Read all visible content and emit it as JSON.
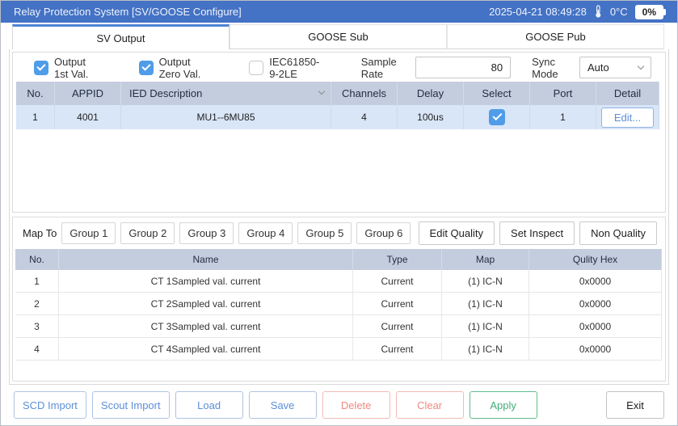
{
  "titlebar": {
    "title": "Relay Protection System [SV/GOOSE Configure]",
    "datetime": "2025-04-21 08:49:28",
    "temperature": "0°C",
    "temperature_icon": "thermometer-icon",
    "battery_level": "0%"
  },
  "tabs": [
    {
      "label": "SV Output",
      "active": true
    },
    {
      "label": "GOOSE Sub",
      "active": false
    },
    {
      "label": "GOOSE Pub",
      "active": false
    }
  ],
  "options": {
    "output_first": {
      "label": "Output 1st Val.",
      "checked": true
    },
    "output_zero": {
      "label": "Output Zero Val.",
      "checked": true
    },
    "iec_9_2le": {
      "label": "IEC61850-9-2LE",
      "checked": false
    },
    "sample_rate_label": "Sample Rate",
    "sample_rate_value": "80",
    "sync_mode_label": "Sync Mode",
    "sync_mode_value": "Auto",
    "sync_mode_icon": "chevron-down-icon"
  },
  "sv_table": {
    "headers": [
      "No.",
      "APPID",
      "IED Description",
      "Channels",
      "Delay",
      "Select",
      "Port",
      "Detail"
    ],
    "header_filter_icon": "chevron-down-icon",
    "rows": [
      {
        "no": "1",
        "appid": "4001",
        "ied_description": "MU1--6MU85",
        "channels": "4",
        "delay": "100us",
        "select": true,
        "port": "1",
        "detail_label": "Edit..."
      }
    ]
  },
  "map_section": {
    "map_to_label": "Map To",
    "groups": [
      "Group 1",
      "Group 2",
      "Group 3",
      "Group 4",
      "Group 5",
      "Group 6"
    ],
    "actions": [
      "Edit Quality",
      "Set Inspect",
      "Non Quality"
    ]
  },
  "channel_table": {
    "headers": [
      "No.",
      "Name",
      "Type",
      "Map",
      "Qulity Hex"
    ],
    "rows": [
      {
        "no": "1",
        "name": "CT 1Sampled val. current",
        "type": "Current",
        "map": "(1) IC-N",
        "quality_hex": "0x0000"
      },
      {
        "no": "2",
        "name": "CT 2Sampled val. current",
        "type": "Current",
        "map": "(1) IC-N",
        "quality_hex": "0x0000"
      },
      {
        "no": "3",
        "name": "CT 3Sampled val. current",
        "type": "Current",
        "map": "(1) IC-N",
        "quality_hex": "0x0000"
      },
      {
        "no": "4",
        "name": "CT 4Sampled val. current",
        "type": "Current",
        "map": "(1) IC-N",
        "quality_hex": "0x0000"
      }
    ]
  },
  "footer": {
    "buttons": [
      {
        "label": "SCD Import",
        "style": "blue"
      },
      {
        "label": "Scout Import",
        "style": "blue"
      },
      {
        "label": "Load",
        "style": "blue"
      },
      {
        "label": "Save",
        "style": "blue"
      },
      {
        "label": "Delete",
        "style": "red"
      },
      {
        "label": "Clear",
        "style": "red"
      },
      {
        "label": "Apply",
        "style": "green"
      },
      {
        "label": "Exit",
        "style": "default"
      }
    ]
  },
  "colors": {
    "titlebar_bg": "#4472c4",
    "tab_active_accent": "#4f83d6",
    "table_header_bg": "#c3cdde",
    "selected_row_bg": "#d9e6f7",
    "checkbox_checked": "#4f9ce8",
    "button_blue": "#5c8fd6",
    "button_red": "#ef8a80",
    "button_green": "#3fae76"
  }
}
